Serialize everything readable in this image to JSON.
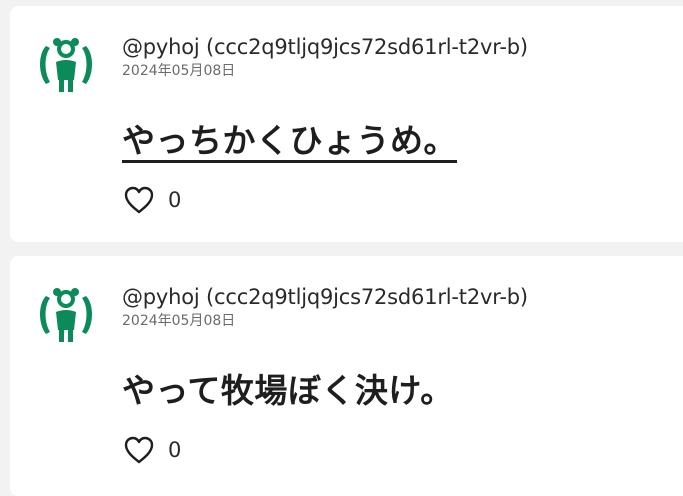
{
  "posts": [
    {
      "handle": "@pyhoj",
      "pubkey": "(ccc2q9tljq9jcs72sd61rl-t2vr-b)",
      "date": "2024年05月08日",
      "text": "やっちかくひょうめ。",
      "likes": "0"
    },
    {
      "handle": "@pyhoj",
      "pubkey": "(ccc2q9tljq9jcs72sd61rl-t2vr-b)",
      "date": "2024年05月08日",
      "text": "やって牧場ぼく決け。",
      "likes": "0"
    }
  ],
  "icons": {
    "avatar": "green-figure-avatar-icon",
    "like": "heart-outline-icon"
  },
  "colors": {
    "avatar_green": "#0b8a5a",
    "background": "#f2f2f2",
    "card": "#ffffff"
  }
}
